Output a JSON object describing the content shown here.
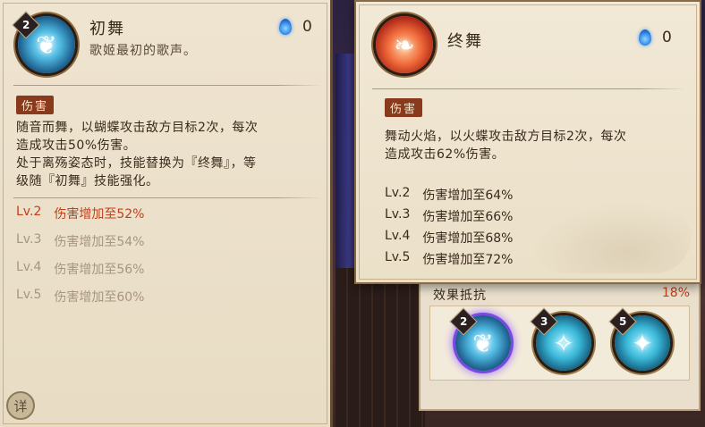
{
  "left_card": {
    "level": "2",
    "title": "初舞",
    "subtitle": "歌姬最初的歌声。",
    "orb_cost": "0",
    "tag": "伤害",
    "desc_lines": [
      "随音而舞，以蝴蝶攻击敌方目标2次，每次",
      "造成攻击50%伤害。",
      "处于离殇姿态时，技能替换为『终舞』，等",
      "级随『初舞』技能强化。"
    ],
    "levels": [
      {
        "lv": "Lv.2",
        "text": "伤害增加至52%"
      },
      {
        "lv": "Lv.3",
        "text": "伤害增加至54%"
      },
      {
        "lv": "Lv.4",
        "text": "伤害增加至56%"
      },
      {
        "lv": "Lv.5",
        "text": "伤害增加至60%"
      }
    ],
    "detail_button": "详"
  },
  "right_card": {
    "title": "终舞",
    "orb_cost": "0",
    "tag": "伤害",
    "desc_lines": [
      "舞动火焰，以火蝶攻击敌方目标2次，每次",
      "造成攻击62%伤害。"
    ],
    "levels": [
      {
        "lv": "Lv.2",
        "text": "伤害增加至64%"
      },
      {
        "lv": "Lv.3",
        "text": "伤害增加至66%"
      },
      {
        "lv": "Lv.4",
        "text": "伤害增加至68%"
      },
      {
        "lv": "Lv.5",
        "text": "伤害增加至72%"
      }
    ]
  },
  "panel": {
    "resist_label": "效果抵抗",
    "resist_value": "18%",
    "slots": [
      {
        "level": "2",
        "icon": "butterfly-skill-icon",
        "selected": true
      },
      {
        "level": "3",
        "icon": "dance-skill-icon",
        "selected": false
      },
      {
        "level": "5",
        "icon": "figure-skill-icon",
        "selected": false
      }
    ]
  },
  "colors": {
    "active_level": "#c0401c",
    "dim_level": "#a69680",
    "selected_ring": "#7a4ae0",
    "tag_bg": "#8a3a1c"
  }
}
